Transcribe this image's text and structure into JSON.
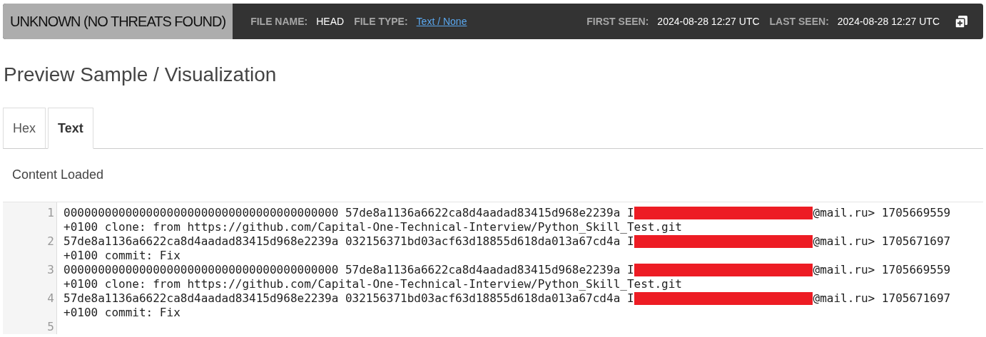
{
  "header": {
    "verdict": "UNKNOWN (NO THREATS FOUND)",
    "file_name_label": "FILE NAME:",
    "file_name": "HEAD",
    "file_type_label": "FILE TYPE:",
    "file_type": "Text / None",
    "first_seen_label": "FIRST SEEN:",
    "first_seen": "2024-08-28 12:27 UTC",
    "last_seen_label": "LAST SEEN:",
    "last_seen": "2024-08-28 12:27 UTC"
  },
  "title": "Preview Sample / Visualization",
  "tabs": [
    {
      "label": "Hex",
      "selected": false
    },
    {
      "label": "Text",
      "selected": true
    }
  ],
  "status": "Content Loaded",
  "lines": [
    {
      "number": "1",
      "before": "0000000000000000000000000000000000000000 57de8a1136a6622ca8d4aadad83415d968e2239a I",
      "redacted": true,
      "after": "@mail.ru> 1705669559",
      "continuation": "+0100 clone: from https://github.com/Capital-One-Technical-Interview/Python_Skill_Test.git"
    },
    {
      "number": "2",
      "before": "57de8a1136a6622ca8d4aadad83415d968e2239a 032156371bd03acf63d18855d618da013a67cd4a I",
      "redacted": true,
      "after": "@mail.ru> 1705671697",
      "continuation": "+0100 commit: Fix"
    },
    {
      "number": "3",
      "before": "0000000000000000000000000000000000000000 57de8a1136a6622ca8d4aadad83415d968e2239a I",
      "redacted": true,
      "after": "@mail.ru> 1705669559",
      "continuation": "+0100 clone: from https://github.com/Capital-One-Technical-Interview/Python_Skill_Test.git"
    },
    {
      "number": "4",
      "before": "57de8a1136a6622ca8d4aadad83415d968e2239a 032156371bd03acf63d18855d618da013a67cd4a I",
      "redacted": true,
      "after": "@mail.ru> 1705671697",
      "continuation": "+0100 commit: Fix"
    },
    {
      "number": "5"
    }
  ]
}
